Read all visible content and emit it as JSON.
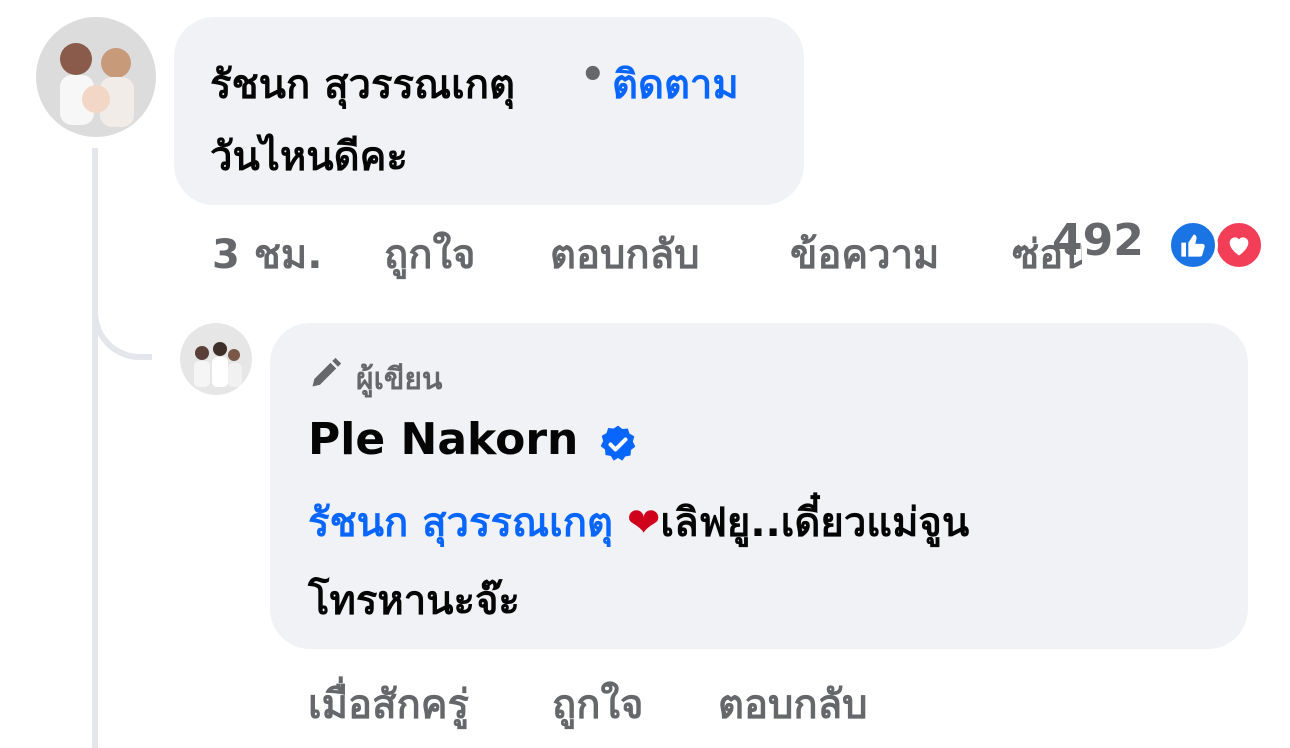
{
  "comment": {
    "author": "รัชนก สุวรรณเกตุ",
    "separator": "•",
    "follow_label": "ติดตาม",
    "text": "วันไหนดีคะ",
    "actions": {
      "time": "3 ชม.",
      "like": "ถูกใจ",
      "reply": "ตอบกลับ",
      "message": "ข้อความ",
      "hide": "ซ่อน"
    },
    "reaction_count": "492",
    "reaction_icons": [
      "like-icon",
      "love-icon"
    ]
  },
  "reply": {
    "badge_label": "ผู้เขียน",
    "badge_icon": "pencil-icon",
    "author": "Ple Nakorn",
    "verified_icon": "verified-badge-icon",
    "mention": "รัชนก สุวรรณเกตุ",
    "text_line1": "เลิฟยู..เดี๋ยวแม่จูน",
    "text_line2": "โทรหานะจ๊ะ",
    "actions": {
      "time": "เมื่อสักครู่",
      "like": "ถูกใจ",
      "reply": "ตอบกลับ"
    }
  },
  "colors": {
    "bubble": "#f0f2f5",
    "link": "#0866ff",
    "muted": "#65676b",
    "like": "#1b74e4",
    "love": "#f33e58"
  }
}
